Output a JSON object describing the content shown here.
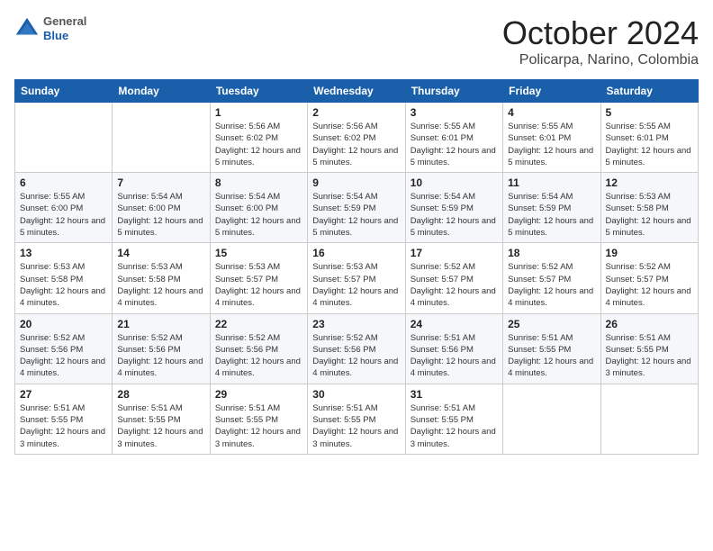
{
  "header": {
    "logo": {
      "general": "General",
      "blue": "Blue"
    },
    "title": "October 2024",
    "location": "Policarpa, Narino, Colombia"
  },
  "days_of_week": [
    "Sunday",
    "Monday",
    "Tuesday",
    "Wednesday",
    "Thursday",
    "Friday",
    "Saturday"
  ],
  "weeks": [
    [
      {
        "day": "",
        "info": ""
      },
      {
        "day": "",
        "info": ""
      },
      {
        "day": "1",
        "info": "Sunrise: 5:56 AM\nSunset: 6:02 PM\nDaylight: 12 hours and 5 minutes."
      },
      {
        "day": "2",
        "info": "Sunrise: 5:56 AM\nSunset: 6:02 PM\nDaylight: 12 hours and 5 minutes."
      },
      {
        "day": "3",
        "info": "Sunrise: 5:55 AM\nSunset: 6:01 PM\nDaylight: 12 hours and 5 minutes."
      },
      {
        "day": "4",
        "info": "Sunrise: 5:55 AM\nSunset: 6:01 PM\nDaylight: 12 hours and 5 minutes."
      },
      {
        "day": "5",
        "info": "Sunrise: 5:55 AM\nSunset: 6:01 PM\nDaylight: 12 hours and 5 minutes."
      }
    ],
    [
      {
        "day": "6",
        "info": "Sunrise: 5:55 AM\nSunset: 6:00 PM\nDaylight: 12 hours and 5 minutes."
      },
      {
        "day": "7",
        "info": "Sunrise: 5:54 AM\nSunset: 6:00 PM\nDaylight: 12 hours and 5 minutes."
      },
      {
        "day": "8",
        "info": "Sunrise: 5:54 AM\nSunset: 6:00 PM\nDaylight: 12 hours and 5 minutes."
      },
      {
        "day": "9",
        "info": "Sunrise: 5:54 AM\nSunset: 5:59 PM\nDaylight: 12 hours and 5 minutes."
      },
      {
        "day": "10",
        "info": "Sunrise: 5:54 AM\nSunset: 5:59 PM\nDaylight: 12 hours and 5 minutes."
      },
      {
        "day": "11",
        "info": "Sunrise: 5:54 AM\nSunset: 5:59 PM\nDaylight: 12 hours and 5 minutes."
      },
      {
        "day": "12",
        "info": "Sunrise: 5:53 AM\nSunset: 5:58 PM\nDaylight: 12 hours and 5 minutes."
      }
    ],
    [
      {
        "day": "13",
        "info": "Sunrise: 5:53 AM\nSunset: 5:58 PM\nDaylight: 12 hours and 4 minutes."
      },
      {
        "day": "14",
        "info": "Sunrise: 5:53 AM\nSunset: 5:58 PM\nDaylight: 12 hours and 4 minutes."
      },
      {
        "day": "15",
        "info": "Sunrise: 5:53 AM\nSunset: 5:57 PM\nDaylight: 12 hours and 4 minutes."
      },
      {
        "day": "16",
        "info": "Sunrise: 5:53 AM\nSunset: 5:57 PM\nDaylight: 12 hours and 4 minutes."
      },
      {
        "day": "17",
        "info": "Sunrise: 5:52 AM\nSunset: 5:57 PM\nDaylight: 12 hours and 4 minutes."
      },
      {
        "day": "18",
        "info": "Sunrise: 5:52 AM\nSunset: 5:57 PM\nDaylight: 12 hours and 4 minutes."
      },
      {
        "day": "19",
        "info": "Sunrise: 5:52 AM\nSunset: 5:57 PM\nDaylight: 12 hours and 4 minutes."
      }
    ],
    [
      {
        "day": "20",
        "info": "Sunrise: 5:52 AM\nSunset: 5:56 PM\nDaylight: 12 hours and 4 minutes."
      },
      {
        "day": "21",
        "info": "Sunrise: 5:52 AM\nSunset: 5:56 PM\nDaylight: 12 hours and 4 minutes."
      },
      {
        "day": "22",
        "info": "Sunrise: 5:52 AM\nSunset: 5:56 PM\nDaylight: 12 hours and 4 minutes."
      },
      {
        "day": "23",
        "info": "Sunrise: 5:52 AM\nSunset: 5:56 PM\nDaylight: 12 hours and 4 minutes."
      },
      {
        "day": "24",
        "info": "Sunrise: 5:51 AM\nSunset: 5:56 PM\nDaylight: 12 hours and 4 minutes."
      },
      {
        "day": "25",
        "info": "Sunrise: 5:51 AM\nSunset: 5:55 PM\nDaylight: 12 hours and 4 minutes."
      },
      {
        "day": "26",
        "info": "Sunrise: 5:51 AM\nSunset: 5:55 PM\nDaylight: 12 hours and 3 minutes."
      }
    ],
    [
      {
        "day": "27",
        "info": "Sunrise: 5:51 AM\nSunset: 5:55 PM\nDaylight: 12 hours and 3 minutes."
      },
      {
        "day": "28",
        "info": "Sunrise: 5:51 AM\nSunset: 5:55 PM\nDaylight: 12 hours and 3 minutes."
      },
      {
        "day": "29",
        "info": "Sunrise: 5:51 AM\nSunset: 5:55 PM\nDaylight: 12 hours and 3 minutes."
      },
      {
        "day": "30",
        "info": "Sunrise: 5:51 AM\nSunset: 5:55 PM\nDaylight: 12 hours and 3 minutes."
      },
      {
        "day": "31",
        "info": "Sunrise: 5:51 AM\nSunset: 5:55 PM\nDaylight: 12 hours and 3 minutes."
      },
      {
        "day": "",
        "info": ""
      },
      {
        "day": "",
        "info": ""
      }
    ]
  ]
}
